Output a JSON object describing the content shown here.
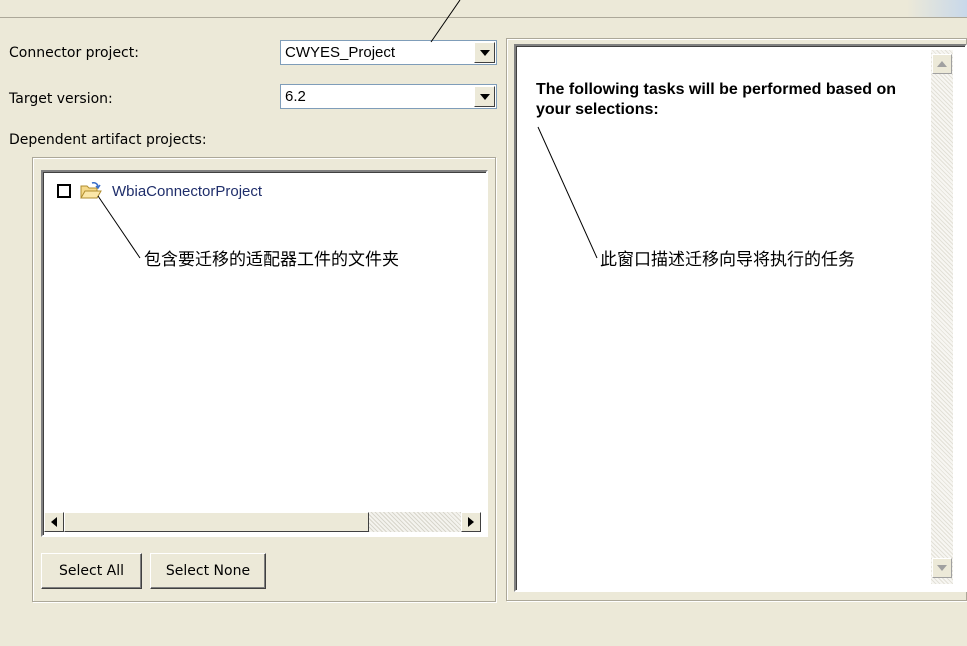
{
  "form": {
    "connector_project_label": "Connector project:",
    "connector_project_value": "CWYES_Project",
    "target_version_label": "Target version:",
    "target_version_value": "6.2",
    "dependent_label": "Dependent artifact projects:"
  },
  "tree": {
    "items": [
      {
        "label": "WbiaConnectorProject",
        "checked": false,
        "icon": "folder-icon"
      }
    ]
  },
  "buttons": {
    "select_all": "Select All",
    "select_none": "Select None"
  },
  "tasks_panel": {
    "heading": "The following tasks will be performed based on your selections:"
  },
  "annotations": {
    "folder_note": "包含要迁移的适配器工件的文件夹",
    "window_note": "此窗口描述迁移向导将执行的任务"
  },
  "colors": {
    "window_bg": "#ece9d8",
    "combo_border": "#7f9db9",
    "tree_text": "#1f2e6b"
  }
}
